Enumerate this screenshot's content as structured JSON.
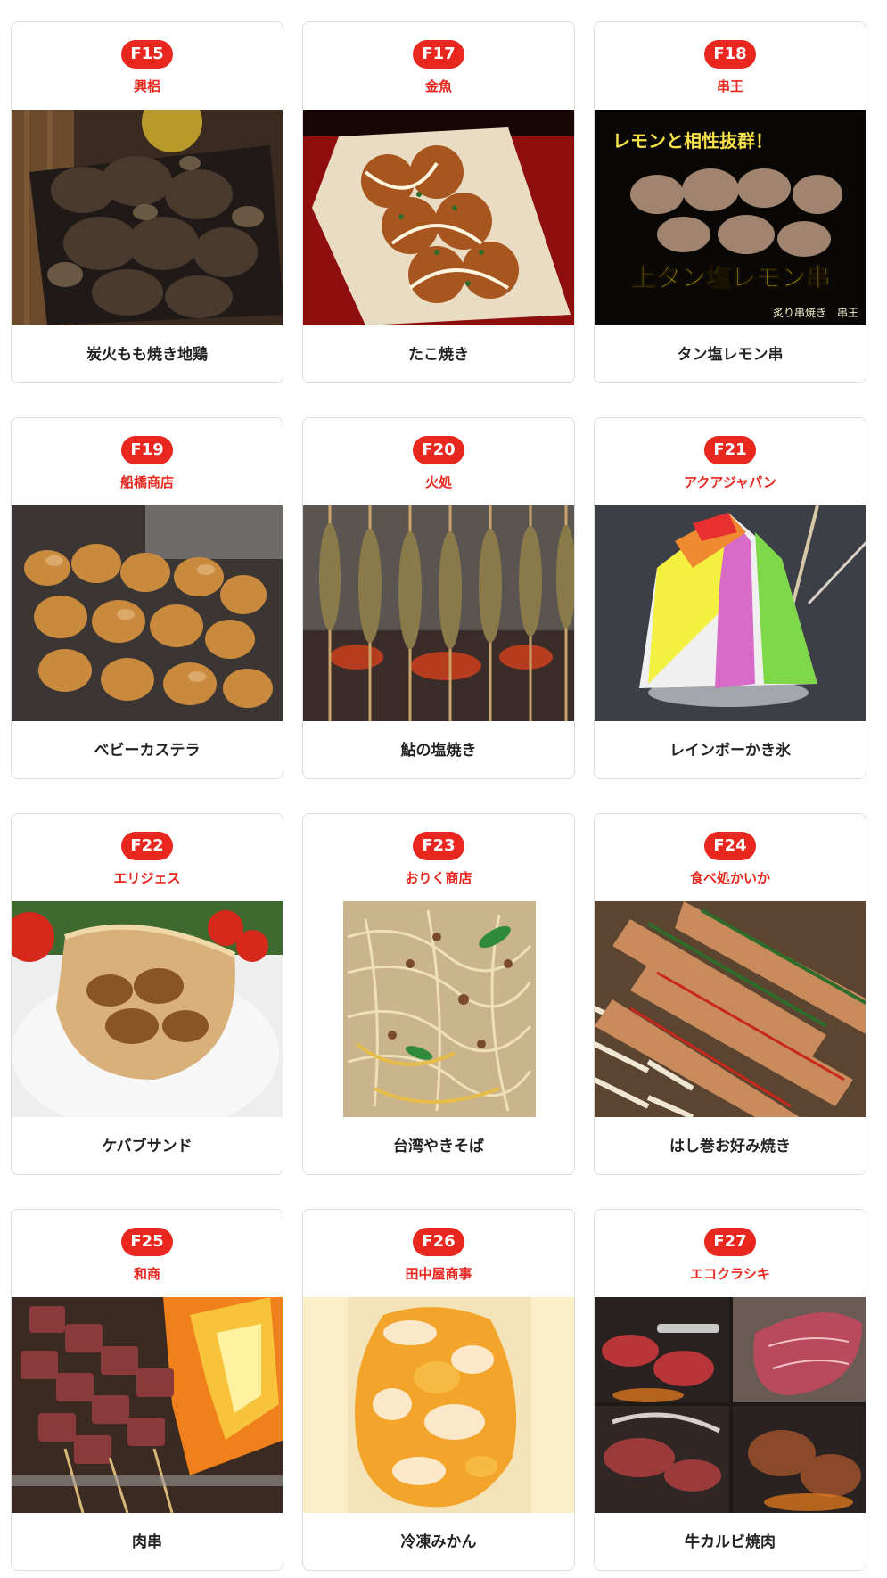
{
  "stalls": [
    {
      "code": "F15",
      "shop": "興梠",
      "dish": "炭火もも焼き地鶏",
      "photo": "grilled-chicken-photo"
    },
    {
      "code": "F17",
      "shop": "金魚",
      "dish": "たこ焼き",
      "photo": "takoyaki-photo"
    },
    {
      "code": "F18",
      "shop": "串王",
      "dish": "タン塩レモン串",
      "photo": "tongue-skewer-photo",
      "photo_text": {
        "top": "レモンと相性抜群！",
        "main": "上タン塩レモン串",
        "sub": "炙り串焼き　串王"
      }
    },
    {
      "code": "F19",
      "shop": "船橋商店",
      "dish": "ベビーカステラ",
      "photo": "baby-castella-photo"
    },
    {
      "code": "F20",
      "shop": "火処",
      "dish": "鮎の塩焼き",
      "photo": "grilled-sweetfish-photo"
    },
    {
      "code": "F21",
      "shop": "アクアジャパン",
      "dish": "レインボーかき氷",
      "photo": "rainbow-shaved-ice-photo"
    },
    {
      "code": "F22",
      "shop": "エリジェス",
      "dish": "ケバブサンド",
      "photo": "kebab-sandwich-photo"
    },
    {
      "code": "F23",
      "shop": "おりく商店",
      "dish": "台湾やきそば",
      "photo": "taiwan-yakisoba-photo"
    },
    {
      "code": "F24",
      "shop": "食べ処かいか",
      "dish": "はし巻お好み焼き",
      "photo": "hashimaki-okonomiyaki-photo"
    },
    {
      "code": "F25",
      "shop": "和商",
      "dish": "肉串",
      "photo": "meat-skewer-photo"
    },
    {
      "code": "F26",
      "shop": "田中屋商事",
      "dish": "冷凍みかん",
      "photo": "frozen-mandarin-photo"
    },
    {
      "code": "F27",
      "shop": "エコクラシキ",
      "dish": "牛カルビ焼肉",
      "photo": "beef-kalbi-photo"
    }
  ],
  "colors": {
    "accent": "#e8271f",
    "card_border": "#dcdcdc",
    "text": "#222222"
  }
}
